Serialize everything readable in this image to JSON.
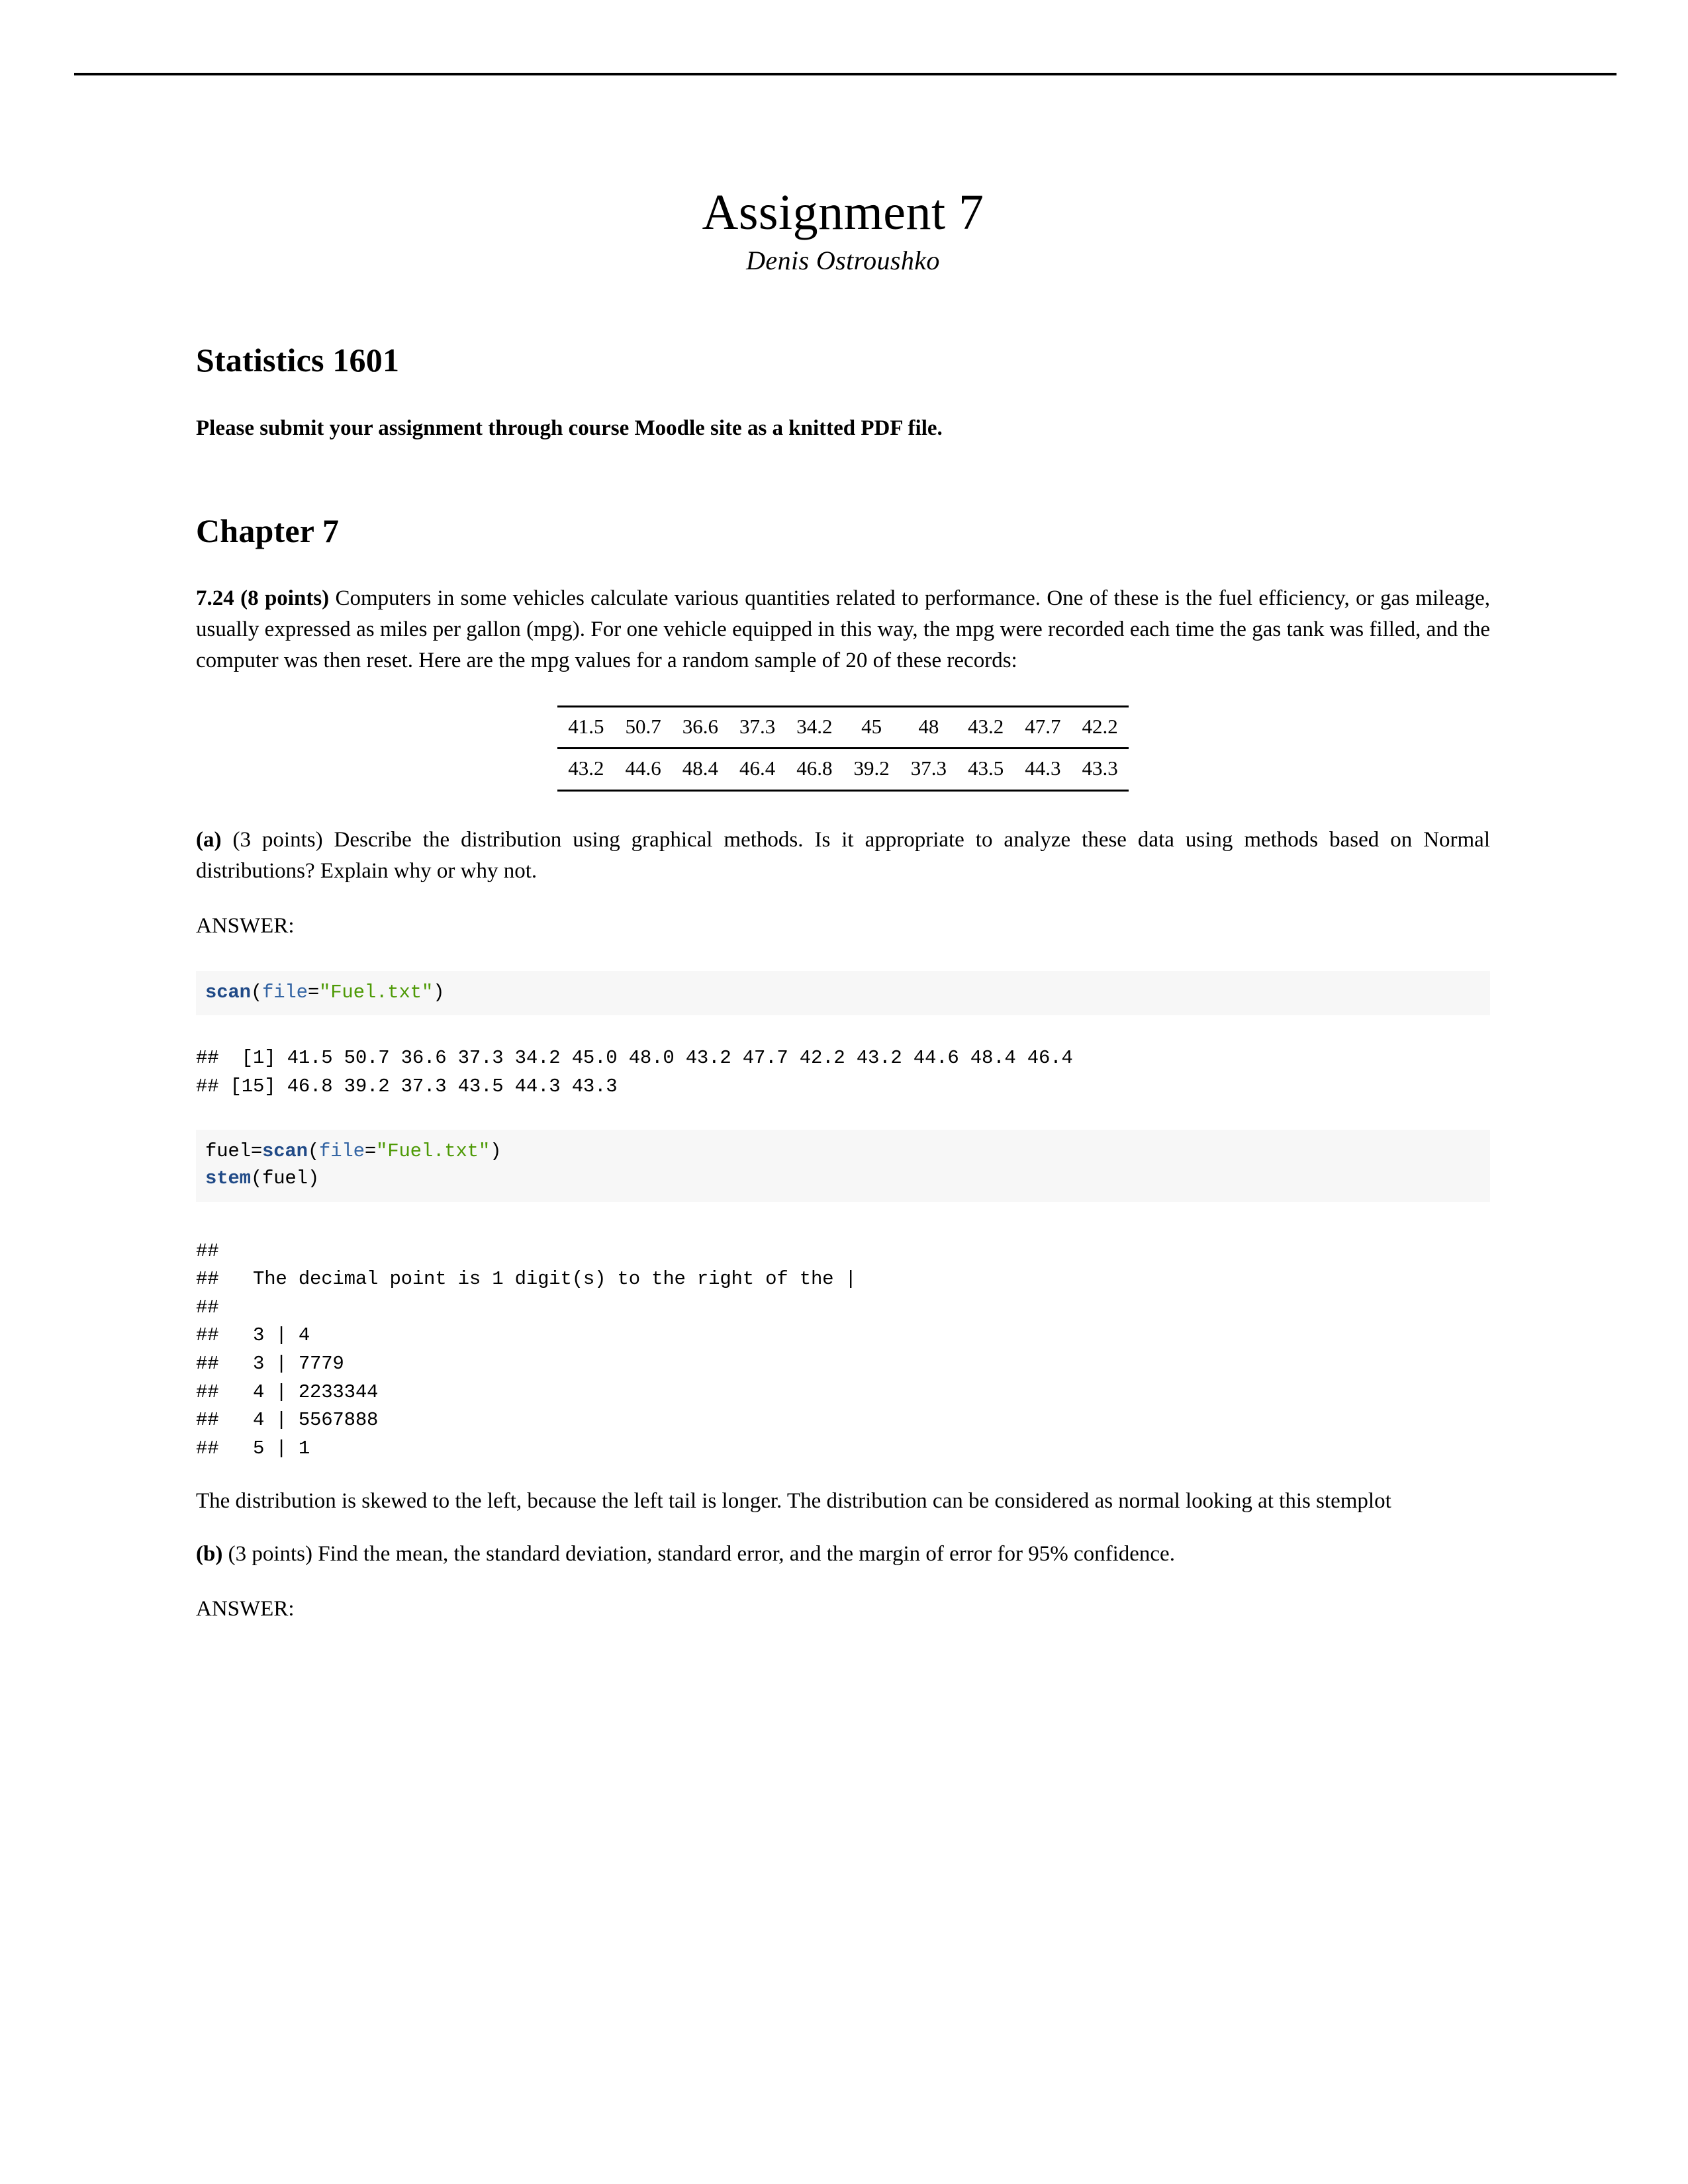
{
  "document": {
    "title": "Assignment 7",
    "author": "Denis Ostroushko",
    "section_heading": "Statistics 1601",
    "submission_note": "Please submit your assignment through course Moodle site as a knitted PDF file.",
    "chapter_heading": "Chapter 7"
  },
  "problem": {
    "number_label": "7.24 (8 points)",
    "prompt": " Computers in some vehicles calculate various quantities related to performance. One of these is the fuel efficiency, or gas mileage, usually expressed as miles per gallon (mpg). For one vehicle equipped in this way, the mpg were recorded each time the gas tank was filled, and the computer was then reset. Here are the mpg values for a random sample of 20 of these records:"
  },
  "data_table": {
    "rows": [
      [
        "41.5",
        "50.7",
        "36.6",
        "37.3",
        "34.2",
        "45",
        "48",
        "43.2",
        "47.7",
        "42.2"
      ],
      [
        "43.2",
        "44.6",
        "48.4",
        "46.4",
        "46.8",
        "39.2",
        "37.3",
        "43.5",
        "44.3",
        "43.3"
      ]
    ]
  },
  "part_a": {
    "label": "(a)",
    "text": " (3 points) Describe the distribution using graphical methods. Is it appropriate to analyze these data using methods based on Normal distributions? Explain why or why not.",
    "answer_label": "ANSWER:",
    "code_block_1": {
      "fn": "scan",
      "open_paren": "(",
      "arg": "file",
      "equals": "=",
      "string": "\"Fuel.txt\"",
      "close_paren": ")"
    },
    "output_1": "##  [1] 41.5 50.7 36.6 37.3 34.2 45.0 48.0 43.2 47.7 42.2 43.2 44.6 48.4 46.4\n## [15] 46.8 39.2 37.3 43.5 44.3 43.3",
    "code_block_2": {
      "var": "fuel",
      "assign": "=",
      "fn": "scan",
      "open_paren": "(",
      "arg": "file",
      "equals": "=",
      "string": "\"Fuel.txt\"",
      "close_paren": ")",
      "fn2": "stem",
      "open_paren2": "(",
      "arg2": "fuel",
      "close_paren2": ")"
    },
    "output_2": "## \n##   The decimal point is 1 digit(s) to the right of the |\n## \n##   3 | 4\n##   3 | 7779\n##   4 | 2233344\n##   4 | 5567888\n##   5 | 1",
    "conclusion": "The distribution is skewed to the left, because the left tail is longer. The distribution can be considered as normal looking at this stemplot"
  },
  "part_b": {
    "label": "(b)",
    "text": " (3 points) Find the mean, the standard deviation, standard error, and the margin of error for 95% confidence.",
    "answer_label": "ANSWER:"
  },
  "colors": {
    "function_blue": "#204a87",
    "argument_blue": "#3465a4",
    "string_green": "#4e9a06",
    "code_background": "#f7f7f7",
    "text_black": "#000000"
  }
}
